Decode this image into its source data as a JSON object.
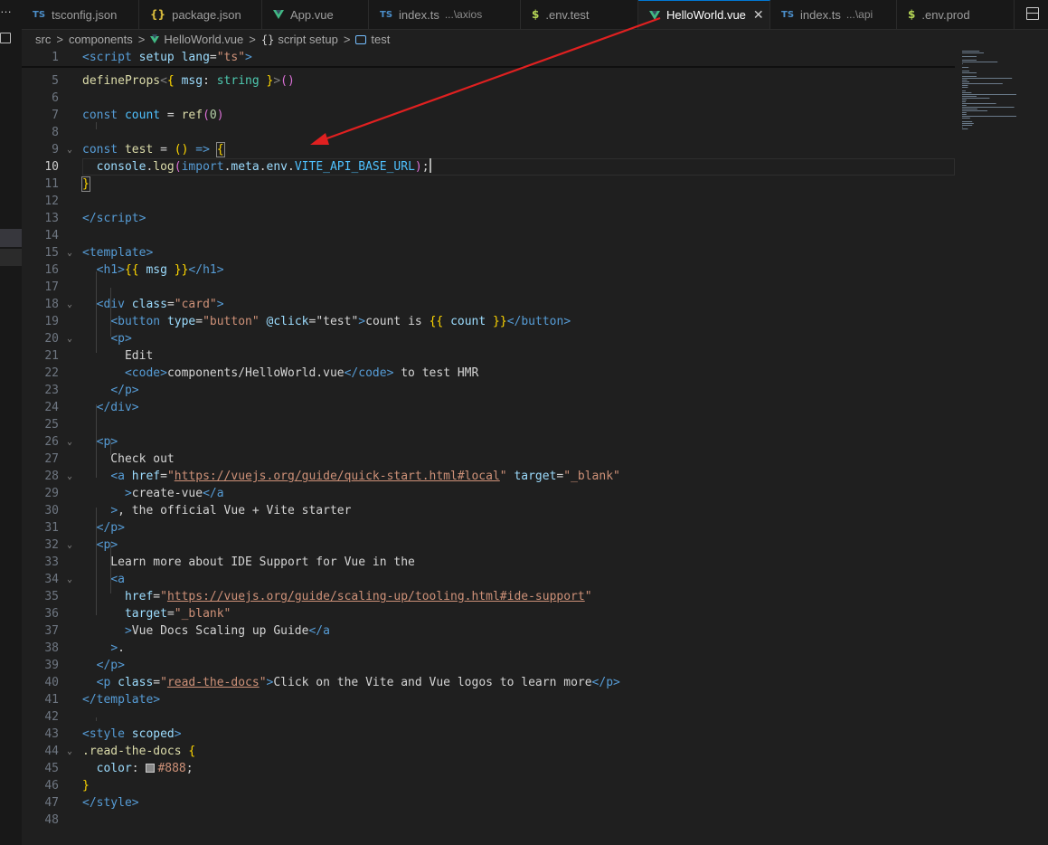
{
  "activity": {
    "overflow_glyph": "…"
  },
  "tabs": [
    {
      "label": "tsconfig.json",
      "icon": "TS",
      "icon_kind": "ts",
      "description": "",
      "active": false
    },
    {
      "label": "package.json",
      "icon": "{}",
      "icon_kind": "json",
      "description": "",
      "active": false
    },
    {
      "label": "App.vue",
      "icon": "vue",
      "icon_kind": "vue",
      "description": "",
      "active": false
    },
    {
      "label": "index.ts",
      "icon": "TS",
      "icon_kind": "ts",
      "description": "...\\axios",
      "active": false
    },
    {
      "label": ".env.test",
      "icon": "$",
      "icon_kind": "env",
      "description": "",
      "active": false
    },
    {
      "label": "HelloWorld.vue",
      "icon": "vue",
      "icon_kind": "vue",
      "description": "",
      "active": true,
      "close": "✕"
    },
    {
      "label": "index.ts",
      "icon": "TS",
      "icon_kind": "ts",
      "description": "...\\api",
      "active": false
    },
    {
      "label": ".env.prod",
      "icon": "$",
      "icon_kind": "env",
      "description": "",
      "active": false
    }
  ],
  "breadcrumb": {
    "seg1": "src",
    "seg2": "components",
    "seg3": "HelloWorld.vue",
    "seg4_icon": "{}",
    "seg4": "script setup",
    "seg5": "test",
    "separator": ">"
  },
  "editor": {
    "current_line": 10,
    "lines": [
      {
        "n": "1",
        "fold": "",
        "tokens": [
          [
            "tag",
            "<script"
          ],
          [
            "txt",
            " "
          ],
          [
            "attr",
            "setup"
          ],
          [
            "txt",
            " "
          ],
          [
            "attr",
            "lang"
          ],
          [
            "txt",
            "="
          ],
          [
            "str",
            "\"ts\""
          ],
          [
            "tag",
            ">"
          ]
        ]
      },
      {
        "n": "5",
        "fold": "",
        "tokens": [
          [
            "fn",
            "defineProps"
          ],
          [
            "br",
            "<"
          ],
          [
            "gold",
            "{"
          ],
          [
            "txt",
            " "
          ],
          [
            "var",
            "msg"
          ],
          [
            "txt",
            ": "
          ],
          [
            "ty",
            "string"
          ],
          [
            "txt",
            " "
          ],
          [
            "gold",
            "}"
          ],
          [
            "br",
            ">"
          ],
          [
            "pink",
            "()"
          ]
        ]
      },
      {
        "n": "6",
        "fold": "",
        "tokens": []
      },
      {
        "n": "7",
        "fold": "",
        "tokens": [
          [
            "kw",
            "const"
          ],
          [
            "txt",
            " "
          ],
          [
            "const",
            "count"
          ],
          [
            "txt",
            " = "
          ],
          [
            "fn",
            "ref"
          ],
          [
            "pink",
            "("
          ],
          [
            "num",
            "0"
          ],
          [
            "pink",
            ")"
          ]
        ]
      },
      {
        "n": "8",
        "fold": "",
        "tokens": []
      },
      {
        "n": "9",
        "fold": "⌄",
        "tokens": [
          [
            "kw",
            "const"
          ],
          [
            "txt",
            " "
          ],
          [
            "fn",
            "test"
          ],
          [
            "txt",
            " = "
          ],
          [
            "gold",
            "()"
          ],
          [
            "txt",
            " "
          ],
          [
            "kw",
            "=>"
          ],
          [
            "txt",
            " "
          ],
          [
            "bmgold",
            "{"
          ]
        ]
      },
      {
        "n": "10",
        "fold": "",
        "tokens": [
          [
            "txt",
            "  "
          ],
          [
            "var",
            "console"
          ],
          [
            "txt",
            "."
          ],
          [
            "fn",
            "log"
          ],
          [
            "pink",
            "("
          ],
          [
            "kw",
            "import"
          ],
          [
            "txt",
            "."
          ],
          [
            "var",
            "meta"
          ],
          [
            "txt",
            "."
          ],
          [
            "var",
            "env"
          ],
          [
            "txt",
            "."
          ],
          [
            "const",
            "VITE_API_BASE_URL"
          ],
          [
            "pink",
            ")"
          ],
          [
            "txt",
            ";"
          ],
          [
            "cursor",
            ""
          ]
        ]
      },
      {
        "n": "11",
        "fold": "",
        "tokens": [
          [
            "bmgold",
            "}"
          ]
        ]
      },
      {
        "n": "12",
        "fold": "",
        "tokens": []
      },
      {
        "n": "13",
        "fold": "",
        "tokens": [
          [
            "tag",
            "</script"
          ],
          [
            "tag",
            ">"
          ]
        ]
      },
      {
        "n": "14",
        "fold": "",
        "tokens": []
      },
      {
        "n": "15",
        "fold": "⌄",
        "tokens": [
          [
            "tag",
            "<template"
          ],
          [
            "tag",
            ">"
          ]
        ]
      },
      {
        "n": "16",
        "fold": "",
        "tokens": [
          [
            "txt",
            "  "
          ],
          [
            "tag",
            "<h1"
          ],
          [
            "tag",
            ">"
          ],
          [
            "gold",
            "{{"
          ],
          [
            "txt",
            " "
          ],
          [
            "var",
            "msg"
          ],
          [
            "txt",
            " "
          ],
          [
            "gold",
            "}}"
          ],
          [
            "tag",
            "</h1"
          ],
          [
            "tag",
            ">"
          ]
        ]
      },
      {
        "n": "17",
        "fold": "",
        "tokens": []
      },
      {
        "n": "18",
        "fold": "⌄",
        "tokens": [
          [
            "txt",
            "  "
          ],
          [
            "tag",
            "<div"
          ],
          [
            "txt",
            " "
          ],
          [
            "attr",
            "class"
          ],
          [
            "txt",
            "="
          ],
          [
            "str",
            "\"card\""
          ],
          [
            "tag",
            ">"
          ]
        ]
      },
      {
        "n": "19",
        "fold": "",
        "tokens": [
          [
            "txt",
            "    "
          ],
          [
            "tag",
            "<button"
          ],
          [
            "txt",
            " "
          ],
          [
            "attr",
            "type"
          ],
          [
            "txt",
            "="
          ],
          [
            "str",
            "\"button\""
          ],
          [
            "txt",
            " "
          ],
          [
            "attr",
            "@click"
          ],
          [
            "txt",
            "="
          ],
          [
            "txt",
            "\"test\""
          ],
          [
            "tag",
            ">"
          ],
          [
            "txt",
            "count is "
          ],
          [
            "gold",
            "{{"
          ],
          [
            "txt",
            " "
          ],
          [
            "var",
            "count"
          ],
          [
            "txt",
            " "
          ],
          [
            "gold",
            "}}"
          ],
          [
            "tag",
            "</button"
          ],
          [
            "tag",
            ">"
          ]
        ]
      },
      {
        "n": "20",
        "fold": "⌄",
        "tokens": [
          [
            "txt",
            "    "
          ],
          [
            "tag",
            "<p"
          ],
          [
            "tag",
            ">"
          ]
        ]
      },
      {
        "n": "21",
        "fold": "",
        "tokens": [
          [
            "txt",
            "      Edit"
          ]
        ]
      },
      {
        "n": "22",
        "fold": "",
        "tokens": [
          [
            "txt",
            "      "
          ],
          [
            "tag",
            "<code"
          ],
          [
            "tag",
            ">"
          ],
          [
            "txt",
            "components/HelloWorld.vue"
          ],
          [
            "tag",
            "</code"
          ],
          [
            "tag",
            ">"
          ],
          [
            "txt",
            " to test HMR"
          ]
        ]
      },
      {
        "n": "23",
        "fold": "",
        "tokens": [
          [
            "txt",
            "    "
          ],
          [
            "tag",
            "</p"
          ],
          [
            "tag",
            ">"
          ]
        ]
      },
      {
        "n": "24",
        "fold": "",
        "tokens": [
          [
            "txt",
            "  "
          ],
          [
            "tag",
            "</div"
          ],
          [
            "tag",
            ">"
          ]
        ]
      },
      {
        "n": "25",
        "fold": "",
        "tokens": []
      },
      {
        "n": "26",
        "fold": "⌄",
        "tokens": [
          [
            "txt",
            "  "
          ],
          [
            "tag",
            "<p"
          ],
          [
            "tag",
            ">"
          ]
        ]
      },
      {
        "n": "27",
        "fold": "",
        "tokens": [
          [
            "txt",
            "    Check out"
          ]
        ]
      },
      {
        "n": "28",
        "fold": "⌄",
        "tokens": [
          [
            "txt",
            "    "
          ],
          [
            "tag",
            "<a"
          ],
          [
            "txt",
            " "
          ],
          [
            "attr",
            "href"
          ],
          [
            "txt",
            "="
          ],
          [
            "str",
            "\""
          ],
          [
            "url",
            "https://vuejs.org/guide/quick-start.html#local"
          ],
          [
            "str",
            "\""
          ],
          [
            "txt",
            " "
          ],
          [
            "attr",
            "target"
          ],
          [
            "txt",
            "="
          ],
          [
            "str",
            "\"_blank\""
          ]
        ]
      },
      {
        "n": "29",
        "fold": "",
        "tokens": [
          [
            "txt",
            "      "
          ],
          [
            "tag",
            ">"
          ],
          [
            "txt",
            "create-vue"
          ],
          [
            "tag",
            "</a"
          ]
        ]
      },
      {
        "n": "30",
        "fold": "",
        "tokens": [
          [
            "txt",
            "    "
          ],
          [
            "tag",
            ">"
          ],
          [
            "txt",
            ", the official Vue + Vite starter"
          ]
        ]
      },
      {
        "n": "31",
        "fold": "",
        "tokens": [
          [
            "txt",
            "  "
          ],
          [
            "tag",
            "</p"
          ],
          [
            "tag",
            ">"
          ]
        ]
      },
      {
        "n": "32",
        "fold": "⌄",
        "tokens": [
          [
            "txt",
            "  "
          ],
          [
            "tag",
            "<p"
          ],
          [
            "tag",
            ">"
          ]
        ]
      },
      {
        "n": "33",
        "fold": "",
        "tokens": [
          [
            "txt",
            "    Learn more about IDE Support for Vue in the"
          ]
        ]
      },
      {
        "n": "34",
        "fold": "⌄",
        "tokens": [
          [
            "txt",
            "    "
          ],
          [
            "tag",
            "<a"
          ]
        ]
      },
      {
        "n": "35",
        "fold": "",
        "tokens": [
          [
            "txt",
            "      "
          ],
          [
            "attr",
            "href"
          ],
          [
            "txt",
            "="
          ],
          [
            "str",
            "\""
          ],
          [
            "url",
            "https://vuejs.org/guide/scaling-up/tooling.html#ide-support"
          ],
          [
            "str",
            "\""
          ]
        ]
      },
      {
        "n": "36",
        "fold": "",
        "tokens": [
          [
            "txt",
            "      "
          ],
          [
            "attr",
            "target"
          ],
          [
            "txt",
            "="
          ],
          [
            "str",
            "\"_blank\""
          ]
        ]
      },
      {
        "n": "37",
        "fold": "",
        "tokens": [
          [
            "txt",
            "      "
          ],
          [
            "tag",
            ">"
          ],
          [
            "txt",
            "Vue Docs Scaling up Guide"
          ],
          [
            "tag",
            "</a"
          ]
        ]
      },
      {
        "n": "38",
        "fold": "",
        "tokens": [
          [
            "txt",
            "    "
          ],
          [
            "tag",
            ">"
          ],
          [
            "txt",
            "."
          ]
        ]
      },
      {
        "n": "39",
        "fold": "",
        "tokens": [
          [
            "txt",
            "  "
          ],
          [
            "tag",
            "</p"
          ],
          [
            "tag",
            ">"
          ]
        ]
      },
      {
        "n": "40",
        "fold": "",
        "tokens": [
          [
            "txt",
            "  "
          ],
          [
            "tag",
            "<p"
          ],
          [
            "txt",
            " "
          ],
          [
            "attr",
            "class"
          ],
          [
            "txt",
            "="
          ],
          [
            "str",
            "\""
          ],
          [
            "url",
            "read-the-docs"
          ],
          [
            "str",
            "\""
          ],
          [
            "tag",
            ">"
          ],
          [
            "txt",
            "Click on the Vite and Vue logos to learn more"
          ],
          [
            "tag",
            "</p"
          ],
          [
            "tag",
            ">"
          ]
        ]
      },
      {
        "n": "41",
        "fold": "",
        "tokens": [
          [
            "tag",
            "</template"
          ],
          [
            "tag",
            ">"
          ]
        ]
      },
      {
        "n": "42",
        "fold": "",
        "tokens": []
      },
      {
        "n": "43",
        "fold": "",
        "tokens": [
          [
            "tag",
            "<style"
          ],
          [
            "txt",
            " "
          ],
          [
            "attr",
            "scoped"
          ],
          [
            "tag",
            ">"
          ]
        ]
      },
      {
        "n": "44",
        "fold": "⌄",
        "tokens": [
          [
            "fn",
            ".read-the-docs"
          ],
          [
            "txt",
            " "
          ],
          [
            "gold",
            "{"
          ]
        ]
      },
      {
        "n": "45",
        "fold": "",
        "tokens": [
          [
            "txt",
            "  "
          ],
          [
            "attr",
            "color"
          ],
          [
            "txt",
            ": "
          ],
          [
            "swatch",
            ""
          ],
          [
            "str",
            "#888"
          ],
          [
            "txt",
            ";"
          ]
        ]
      },
      {
        "n": "46",
        "fold": "",
        "tokens": [
          [
            "gold",
            "}"
          ]
        ]
      },
      {
        "n": "47",
        "fold": "",
        "tokens": [
          [
            "tag",
            "</style"
          ],
          [
            "tag",
            ">"
          ]
        ]
      },
      {
        "n": "48",
        "fold": "",
        "tokens": []
      }
    ]
  },
  "colors": {
    "editor_bg": "#1f1f1f",
    "tab_active_border": "#0078d4",
    "annotation_arrow": "#e02020"
  }
}
